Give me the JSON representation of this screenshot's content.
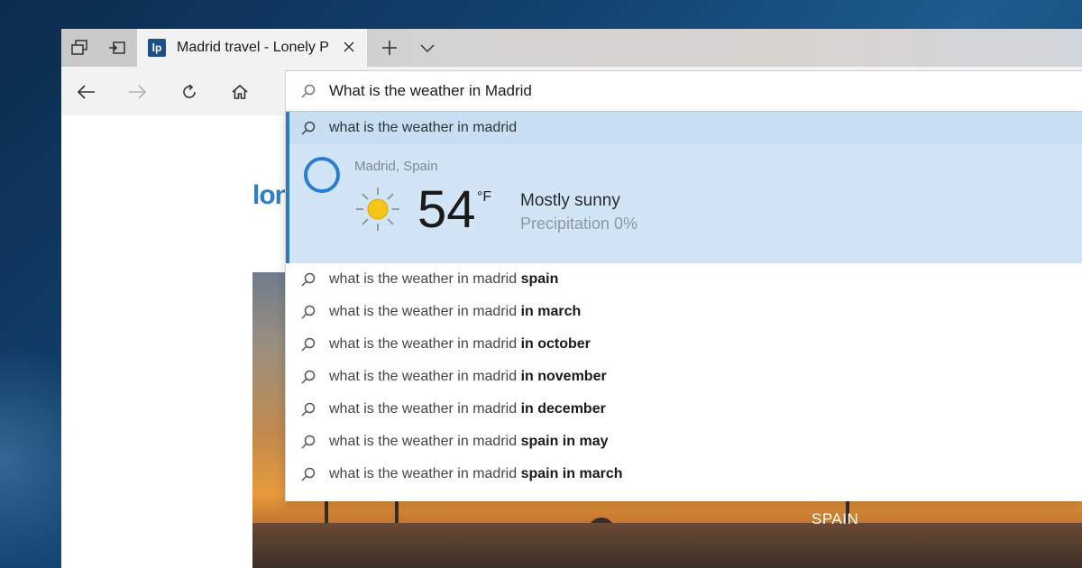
{
  "tabbar": {
    "tab_title": "Madrid travel - Lonely P",
    "favicon_text": "lp",
    "favicon_color": "#1c4f8a"
  },
  "address_bar": {
    "value": "What is the weather in Madrid"
  },
  "top_suggestion": "what is the weather in madrid",
  "weather": {
    "location": "Madrid, Spain",
    "temperature": "54",
    "unit": "°F",
    "condition": "Mostly sunny",
    "precipitation": "Precipitation 0%",
    "icon": "sun-icon",
    "accent": "#2b7bc4"
  },
  "suggestions": [
    {
      "base": "what is the weather in madrid",
      "bold": "spain"
    },
    {
      "base": "what is the weather in madrid",
      "bold": "in march"
    },
    {
      "base": "what is the weather in madrid",
      "bold": "in october"
    },
    {
      "base": "what is the weather in madrid",
      "bold": "in november"
    },
    {
      "base": "what is the weather in madrid",
      "bold": "in december"
    },
    {
      "base": "what is the weather in madrid",
      "bold": "spain in may"
    },
    {
      "base": "what is the weather in madrid",
      "bold": "spain in march"
    }
  ],
  "page": {
    "logo_fragment": "lon",
    "hero_label": "SPAIN"
  },
  "icons": {
    "tab_bar": [
      "tabs-aside-icon",
      "restore-tabs-icon",
      "new-tab-icon",
      "tab-list-chevron-icon",
      "close-icon"
    ],
    "nav": [
      "back-icon",
      "forward-icon",
      "refresh-icon",
      "home-icon",
      "search-icon"
    ]
  }
}
